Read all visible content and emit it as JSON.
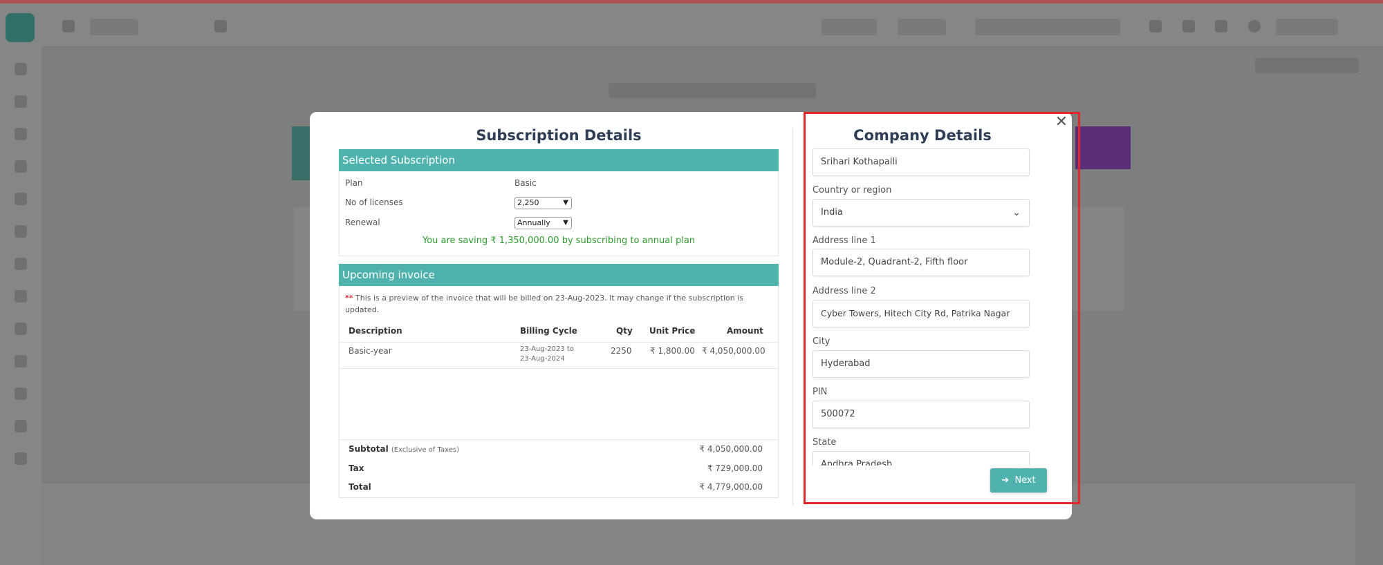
{
  "modal": {
    "close_glyph": "✕"
  },
  "subscription": {
    "title": "Subscription Details",
    "selected_heading": "Selected Subscription",
    "plan_label": "Plan",
    "plan_value": "Basic",
    "licenses_label": "No of licenses",
    "licenses_value": "2,250",
    "renewal_label": "Renewal",
    "renewal_value": "Annually",
    "saving_text": "You are saving ₹ 1,350,000.00 by subscribing to annual plan",
    "invoice_heading": "Upcoming invoice",
    "note_star": "**",
    "note_text": " This is a preview of the invoice that will be billed on 23-Aug-2023. It may change if the subscription is updated.",
    "table": {
      "headers": [
        "Description",
        "Billing Cycle",
        "Qty",
        "Unit Price",
        "Amount"
      ],
      "rows": [
        {
          "description": "Basic-year",
          "cycle_from": "23-Aug-2023 to",
          "cycle_to": "23-Aug-2024",
          "qty": "2250",
          "unit_price": "₹ 1,800.00",
          "amount": "₹ 4,050,000.00"
        }
      ]
    },
    "totals": {
      "subtotal_label": "Subtotal",
      "subtotal_note": "(Exclusive of Taxes)",
      "subtotal_value": "₹ 4,050,000.00",
      "tax_label": "Tax",
      "tax_value": "₹ 729,000.00",
      "total_label": "Total",
      "total_value": "₹ 4,779,000.00"
    }
  },
  "company": {
    "title": "Company Details",
    "name_value": "Srihari Kothapalli",
    "country_label": "Country or region",
    "country_value": "India",
    "address1_label": "Address line 1",
    "address1_value": "Module-2, Quadrant-2, Fifth floor",
    "address2_label": "Address line 2",
    "address2_value": "Cyber Towers, Hitech City Rd, Patrika Nagar",
    "city_label": "City",
    "city_value": "Hyderabad",
    "pin_label": "PIN",
    "pin_value": "500072",
    "state_label": "State",
    "state_value": "Andhra Pradesh",
    "next_label": "Next",
    "next_icon": "arrow-right-icon"
  },
  "colors": {
    "accent": "#50b2ad",
    "heading": "#2e3e55",
    "saving": "#2e9b2e",
    "highlight": "#e3262b"
  }
}
